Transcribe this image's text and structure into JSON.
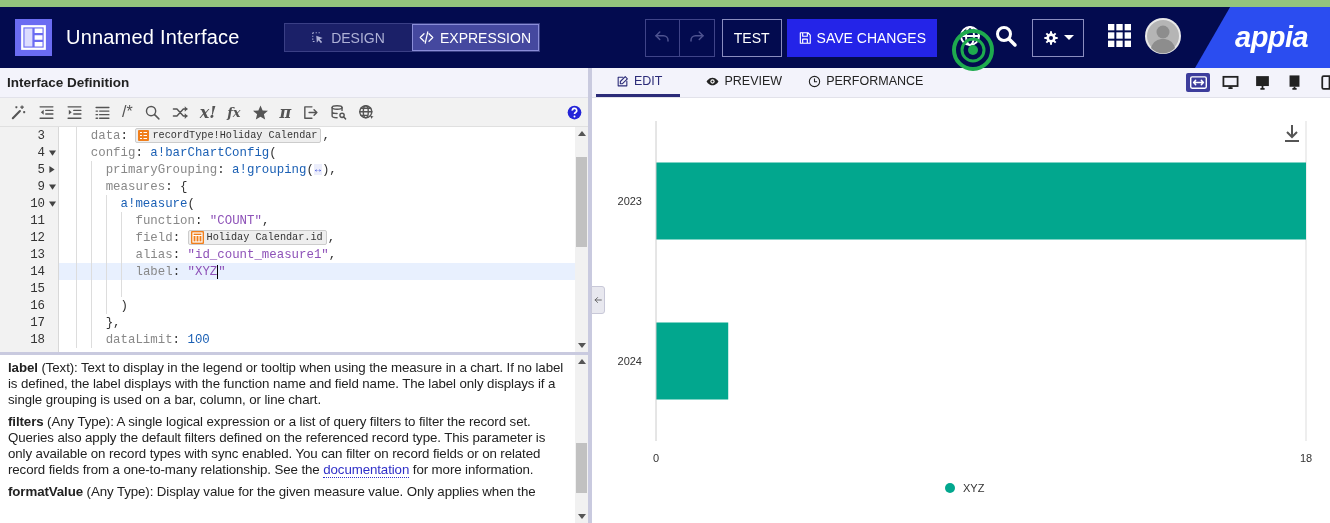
{
  "header": {
    "title": "Unnamed Interface",
    "mode_tabs": [
      {
        "label": "DESIGN",
        "selected": false
      },
      {
        "label": "EXPRESSION",
        "selected": true
      }
    ],
    "history_buttons": [
      {
        "disabled": true
      },
      {
        "disabled": true
      }
    ],
    "test_button": "TEST",
    "save_button": "SAVE CHANGES",
    "brand": "appia"
  },
  "editor": {
    "title": "Interface Definition",
    "toolbar": [
      {
        "kind": "icon"
      },
      {
        "kind": "icon"
      },
      {
        "kind": "icon"
      },
      {
        "kind": "icon"
      },
      {
        "kind": "glyph",
        "text": "/*"
      },
      {
        "kind": "icon"
      },
      {
        "kind": "icon"
      },
      {
        "kind": "glyph",
        "text": "x!"
      },
      {
        "kind": "glyph",
        "text": "fx"
      },
      {
        "kind": "icon"
      },
      {
        "kind": "glyph",
        "text": "π"
      },
      {
        "kind": "icon"
      },
      {
        "kind": "icon"
      },
      {
        "kind": "icon"
      }
    ],
    "code_lines": [
      {
        "number": "3",
        "segments": [
          {
            "kind": "key",
            "text": "data"
          },
          {
            "kind": "punct",
            "text": ": "
          },
          {
            "kind": "record_chip",
            "text": "recordType!Holiday Calendar"
          },
          {
            "kind": "punct",
            "text": ","
          }
        ]
      },
      {
        "number": "4",
        "expanded": true,
        "segments": [
          {
            "kind": "key",
            "text": "config"
          },
          {
            "kind": "punct",
            "text": ": "
          },
          {
            "kind": "func",
            "text": "a!barChartConfig"
          },
          {
            "kind": "punct",
            "text": "("
          }
        ],
        "children": [
          {
            "number": "5",
            "expanded": false,
            "segments": [
              {
                "kind": "key",
                "text": "primaryGrouping"
              },
              {
                "kind": "punct",
                "text": ": "
              },
              {
                "kind": "func",
                "text": "a!grouping"
              },
              {
                "kind": "punct",
                "text": "("
              },
              {
                "kind": "folded",
                "text": "↔"
              },
              {
                "kind": "punct",
                "text": "),"
              }
            ]
          },
          {
            "number": "9",
            "expanded": true,
            "segments": [
              {
                "kind": "key",
                "text": "measures"
              },
              {
                "kind": "punct",
                "text": ": {"
              }
            ],
            "children": [
              {
                "number": "10",
                "expanded": true,
                "segments": [
                  {
                    "kind": "func",
                    "text": "a!measure"
                  },
                  {
                    "kind": "punct",
                    "text": "("
                  }
                ],
                "children": [
                  {
                    "number": "11",
                    "segments": [
                      {
                        "kind": "key",
                        "text": "function"
                      },
                      {
                        "kind": "punct",
                        "text": ": "
                      },
                      {
                        "kind": "string",
                        "text": "\"COUNT\""
                      },
                      {
                        "kind": "punct",
                        "text": ","
                      }
                    ]
                  },
                  {
                    "number": "12",
                    "segments": [
                      {
                        "kind": "key",
                        "text": "field"
                      },
                      {
                        "kind": "punct",
                        "text": ": "
                      },
                      {
                        "kind": "field_chip",
                        "text": "Holiday Calendar.id"
                      },
                      {
                        "kind": "punct",
                        "text": ","
                      }
                    ]
                  },
                  {
                    "number": "13",
                    "segments": [
                      {
                        "kind": "key",
                        "text": "alias"
                      },
                      {
                        "kind": "punct",
                        "text": ": "
                      },
                      {
                        "kind": "string",
                        "text": "\"id_count_measure1\""
                      },
                      {
                        "kind": "punct",
                        "text": ","
                      }
                    ]
                  },
                  {
                    "number": "14",
                    "current": true,
                    "segments": [
                      {
                        "kind": "key",
                        "text": "label"
                      },
                      {
                        "kind": "punct",
                        "text": ": "
                      },
                      {
                        "kind": "string",
                        "text": "\"XYZ"
                      },
                      {
                        "kind": "caret"
                      },
                      {
                        "kind": "string",
                        "text": "\""
                      }
                    ]
                  },
                  {
                    "number": "15"
                  }
                ]
              },
              {
                "number": "16",
                "segments": [
                  {
                    "kind": "punct",
                    "text": ")"
                  }
                ]
              }
            ]
          },
          {
            "number": "17",
            "segments": [
              {
                "kind": "punct",
                "text": "},"
              }
            ]
          },
          {
            "number": "18",
            "segments": [
              {
                "kind": "key",
                "text": "dataLimit"
              },
              {
                "kind": "punct",
                "text": ": "
              },
              {
                "kind": "number",
                "text": "100"
              }
            ]
          }
        ]
      }
    ],
    "docs": [
      {
        "before": "**label** (Text): Text to display in the legend or tooltip when using the measure in a chart. If no label is defined, the label displays with the function name and field name. The label only displays if a single grouping is used on a bar, column, or line chart."
      },
      {
        "before": "**filters** (Any Type): A single logical expression or a list of query filters to filter the record set. Queries also apply the default filters defined on the referenced record type. This parameter is only available on record types with sync enabled. You can filter on record fields or on related record fields from a one-to-many relationship. See the ",
        "link": "documentation",
        "after": " for more information."
      },
      {
        "before": "**formatValue** (Any Type): Display value for the given measure value. Only applies when the"
      }
    ]
  },
  "preview": {
    "tabs": [
      {
        "label": "EDIT",
        "selected": true
      },
      {
        "label": "PREVIEW",
        "selected": false
      },
      {
        "label": "PERFORMANCE",
        "selected": false
      }
    ],
    "device_buttons": [
      {
        "selected": true
      },
      {
        "selected": false
      },
      {
        "selected": false
      },
      {
        "selected": false
      },
      {
        "selected": false
      }
    ],
    "chart_data": {
      "type": "bar",
      "orientation": "horizontal",
      "categories": [
        "2023",
        "2024"
      ],
      "series": [
        {
          "name": "XYZ",
          "color": "#02a78e",
          "values": [
            18,
            2
          ]
        }
      ],
      "xlim": [
        0,
        18
      ],
      "xticks": [
        0,
        18
      ]
    }
  }
}
